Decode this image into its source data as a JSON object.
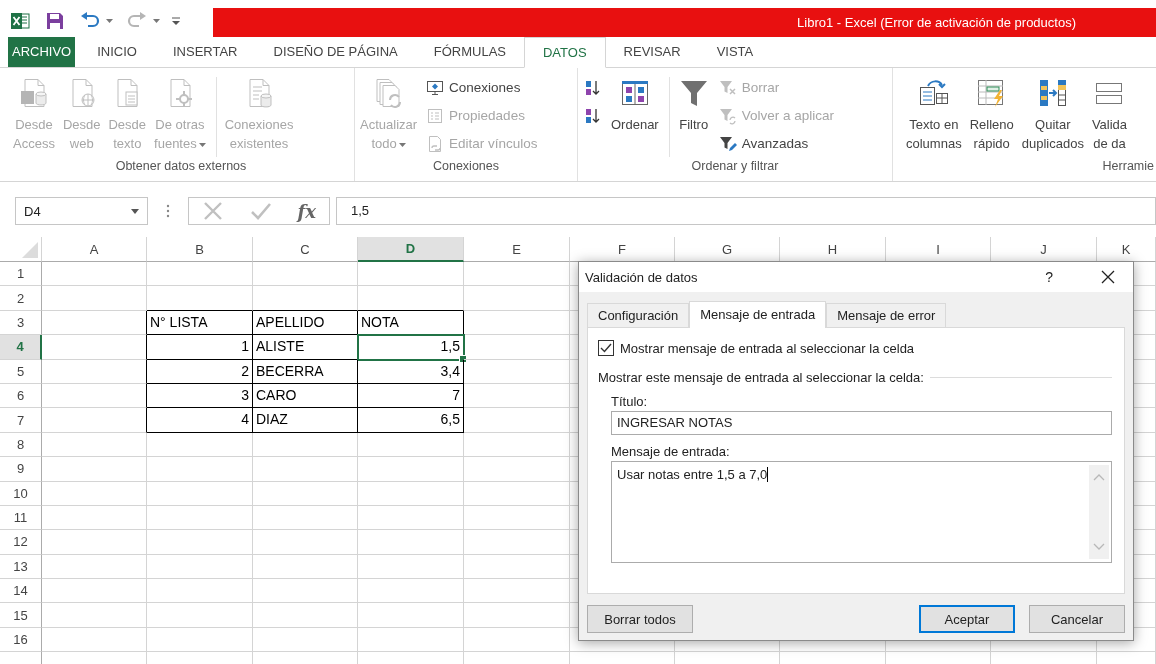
{
  "window": {
    "title": "Libro1 - Excel (Error de activación de productos)"
  },
  "menu_tabs": [
    {
      "label": "ARCHIVO",
      "kind": "file",
      "selected": false
    },
    {
      "label": "INICIO",
      "kind": "tab",
      "selected": false
    },
    {
      "label": "INSERTAR",
      "kind": "tab",
      "selected": false
    },
    {
      "label": "DISEÑO DE PÁGINA",
      "kind": "tab",
      "selected": false
    },
    {
      "label": "FÓRMULAS",
      "kind": "tab",
      "selected": false
    },
    {
      "label": "DATOS",
      "kind": "tab",
      "selected": true
    },
    {
      "label": "REVISAR",
      "kind": "tab",
      "selected": false
    },
    {
      "label": "VISTA",
      "kind": "tab",
      "selected": false
    }
  ],
  "ribbon": {
    "groups": [
      {
        "label": "Obtener datos externos",
        "controls": [
          {
            "kind": "large",
            "lines": [
              "Desde",
              "Access"
            ],
            "disabled": true,
            "menu": false,
            "separated": false
          },
          {
            "kind": "large",
            "lines": [
              "Desde",
              "web"
            ],
            "disabled": true,
            "menu": false,
            "separated": false
          },
          {
            "kind": "large",
            "lines": [
              "Desde",
              "texto"
            ],
            "disabled": true,
            "menu": false,
            "separated": false
          },
          {
            "kind": "large",
            "lines": [
              "De otras",
              "fuentes"
            ],
            "disabled": true,
            "menu": true,
            "separated": false
          },
          {
            "kind": "large",
            "lines": [
              "Conexiones",
              "existentes"
            ],
            "disabled": true,
            "menu": false,
            "separated": true
          }
        ]
      },
      {
        "label": "Conexiones",
        "controls": [
          {
            "kind": "large",
            "lines": [
              "Actualizar",
              "todo"
            ],
            "disabled": true,
            "menu": true,
            "separated": false
          },
          {
            "kind": "stack",
            "items": [
              {
                "label": "Conexiones",
                "disabled": false
              },
              {
                "label": "Propiedades",
                "disabled": true
              },
              {
                "label": "Editar vínculos",
                "disabled": true
              }
            ]
          }
        ]
      },
      {
        "label": "Ordenar y filtrar",
        "controls": [
          {
            "kind": "stack",
            "items": [
              {
                "disabled": false
              },
              {
                "disabled": false
              }
            ]
          },
          {
            "kind": "large",
            "lines": [
              "Ordenar"
            ],
            "disabled": false,
            "menu": false,
            "separated": false
          },
          {
            "kind": "large",
            "lines": [
              "Filtro"
            ],
            "disabled": false,
            "menu": false,
            "separated": true
          },
          {
            "kind": "stack",
            "items": [
              {
                "label": "Borrar",
                "disabled": true
              },
              {
                "label": "Volver a aplicar",
                "disabled": true
              },
              {
                "label": "Avanzadas",
                "disabled": false
              }
            ]
          }
        ]
      },
      {
        "label": "Herramie",
        "controls": [
          {
            "kind": "large",
            "lines": [
              "Texto en",
              "columnas"
            ],
            "disabled": false,
            "menu": false,
            "separated": false
          },
          {
            "kind": "large",
            "lines": [
              "Relleno",
              "rápido"
            ],
            "disabled": false,
            "menu": false,
            "separated": false
          },
          {
            "kind": "large",
            "lines": [
              "Quitar",
              "duplicados"
            ],
            "disabled": false,
            "menu": false,
            "separated": false
          },
          {
            "kind": "large",
            "lines": [
              "Valida",
              "de da"
            ],
            "disabled": false,
            "menu": false,
            "separated": false
          }
        ]
      }
    ]
  },
  "formula_bar": {
    "name_box": "D4",
    "function_label": "fx",
    "formula": "1,5"
  },
  "sheet": {
    "columns": [
      {
        "label": "A",
        "selected": false
      },
      {
        "label": "B",
        "selected": false
      },
      {
        "label": "C",
        "selected": false
      },
      {
        "label": "D",
        "selected": true
      },
      {
        "label": "E",
        "selected": false
      },
      {
        "label": "F",
        "selected": false
      },
      {
        "label": "G",
        "selected": false
      },
      {
        "label": "H",
        "selected": false
      },
      {
        "label": "I",
        "selected": false
      },
      {
        "label": "J",
        "selected": false
      },
      {
        "label": "K",
        "selected": false
      }
    ],
    "rows": [
      {
        "label": "1",
        "selected": false
      },
      {
        "label": "2",
        "selected": false
      },
      {
        "label": "3",
        "selected": false
      },
      {
        "label": "4",
        "selected": true
      },
      {
        "label": "5",
        "selected": false
      },
      {
        "label": "6",
        "selected": false
      },
      {
        "label": "7",
        "selected": false
      },
      {
        "label": "8",
        "selected": false
      },
      {
        "label": "9",
        "selected": false
      },
      {
        "label": "10",
        "selected": false
      },
      {
        "label": "11",
        "selected": false
      },
      {
        "label": "12",
        "selected": false
      },
      {
        "label": "13",
        "selected": false
      },
      {
        "label": "14",
        "selected": false
      },
      {
        "label": "15",
        "selected": false
      },
      {
        "label": "16",
        "selected": false
      }
    ]
  },
  "table": {
    "columns": [
      {
        "label": "N° LISTA",
        "kind": "number"
      },
      {
        "label": "APELLIDO",
        "kind": "text"
      },
      {
        "label": "NOTA",
        "kind": "number"
      }
    ],
    "rows": [
      {
        "cells": [
          {
            "text": "1",
            "selected": false
          },
          {
            "text": "ALISTE",
            "selected": false
          },
          {
            "text": "1,5",
            "selected": true
          }
        ]
      },
      {
        "cells": [
          {
            "text": "2",
            "selected": false
          },
          {
            "text": "BECERRA",
            "selected": false
          },
          {
            "text": "3,4",
            "selected": false
          }
        ]
      },
      {
        "cells": [
          {
            "text": "3",
            "selected": false
          },
          {
            "text": "CARO",
            "selected": false
          },
          {
            "text": "7",
            "selected": false
          }
        ]
      },
      {
        "cells": [
          {
            "text": "4",
            "selected": false
          },
          {
            "text": "DIAZ",
            "selected": false
          },
          {
            "text": "6,5",
            "selected": false
          }
        ]
      }
    ]
  },
  "dialog": {
    "title": "Validación de datos",
    "help": "?",
    "tabs": [
      {
        "label": "Configuración",
        "selected": false
      },
      {
        "label": "Mensaje de entrada",
        "selected": true
      },
      {
        "label": "Mensaje de error",
        "selected": false
      }
    ],
    "show_message": {
      "label": "Mostrar mensaje de entrada al seleccionar la celda",
      "checked": true
    },
    "section_label": "Mostrar este mensaje de entrada al seleccionar la celda:",
    "title_field": {
      "label": "Título:",
      "value": "INGRESAR NOTAS"
    },
    "message_field": {
      "label": "Mensaje de entrada:",
      "value": "Usar notas entre 1,5 a 7,0"
    },
    "buttons": [
      {
        "label": "Borrar todos",
        "default": false
      },
      {
        "label": "Aceptar",
        "default": true
      },
      {
        "label": "Cancelar",
        "default": false
      }
    ]
  }
}
